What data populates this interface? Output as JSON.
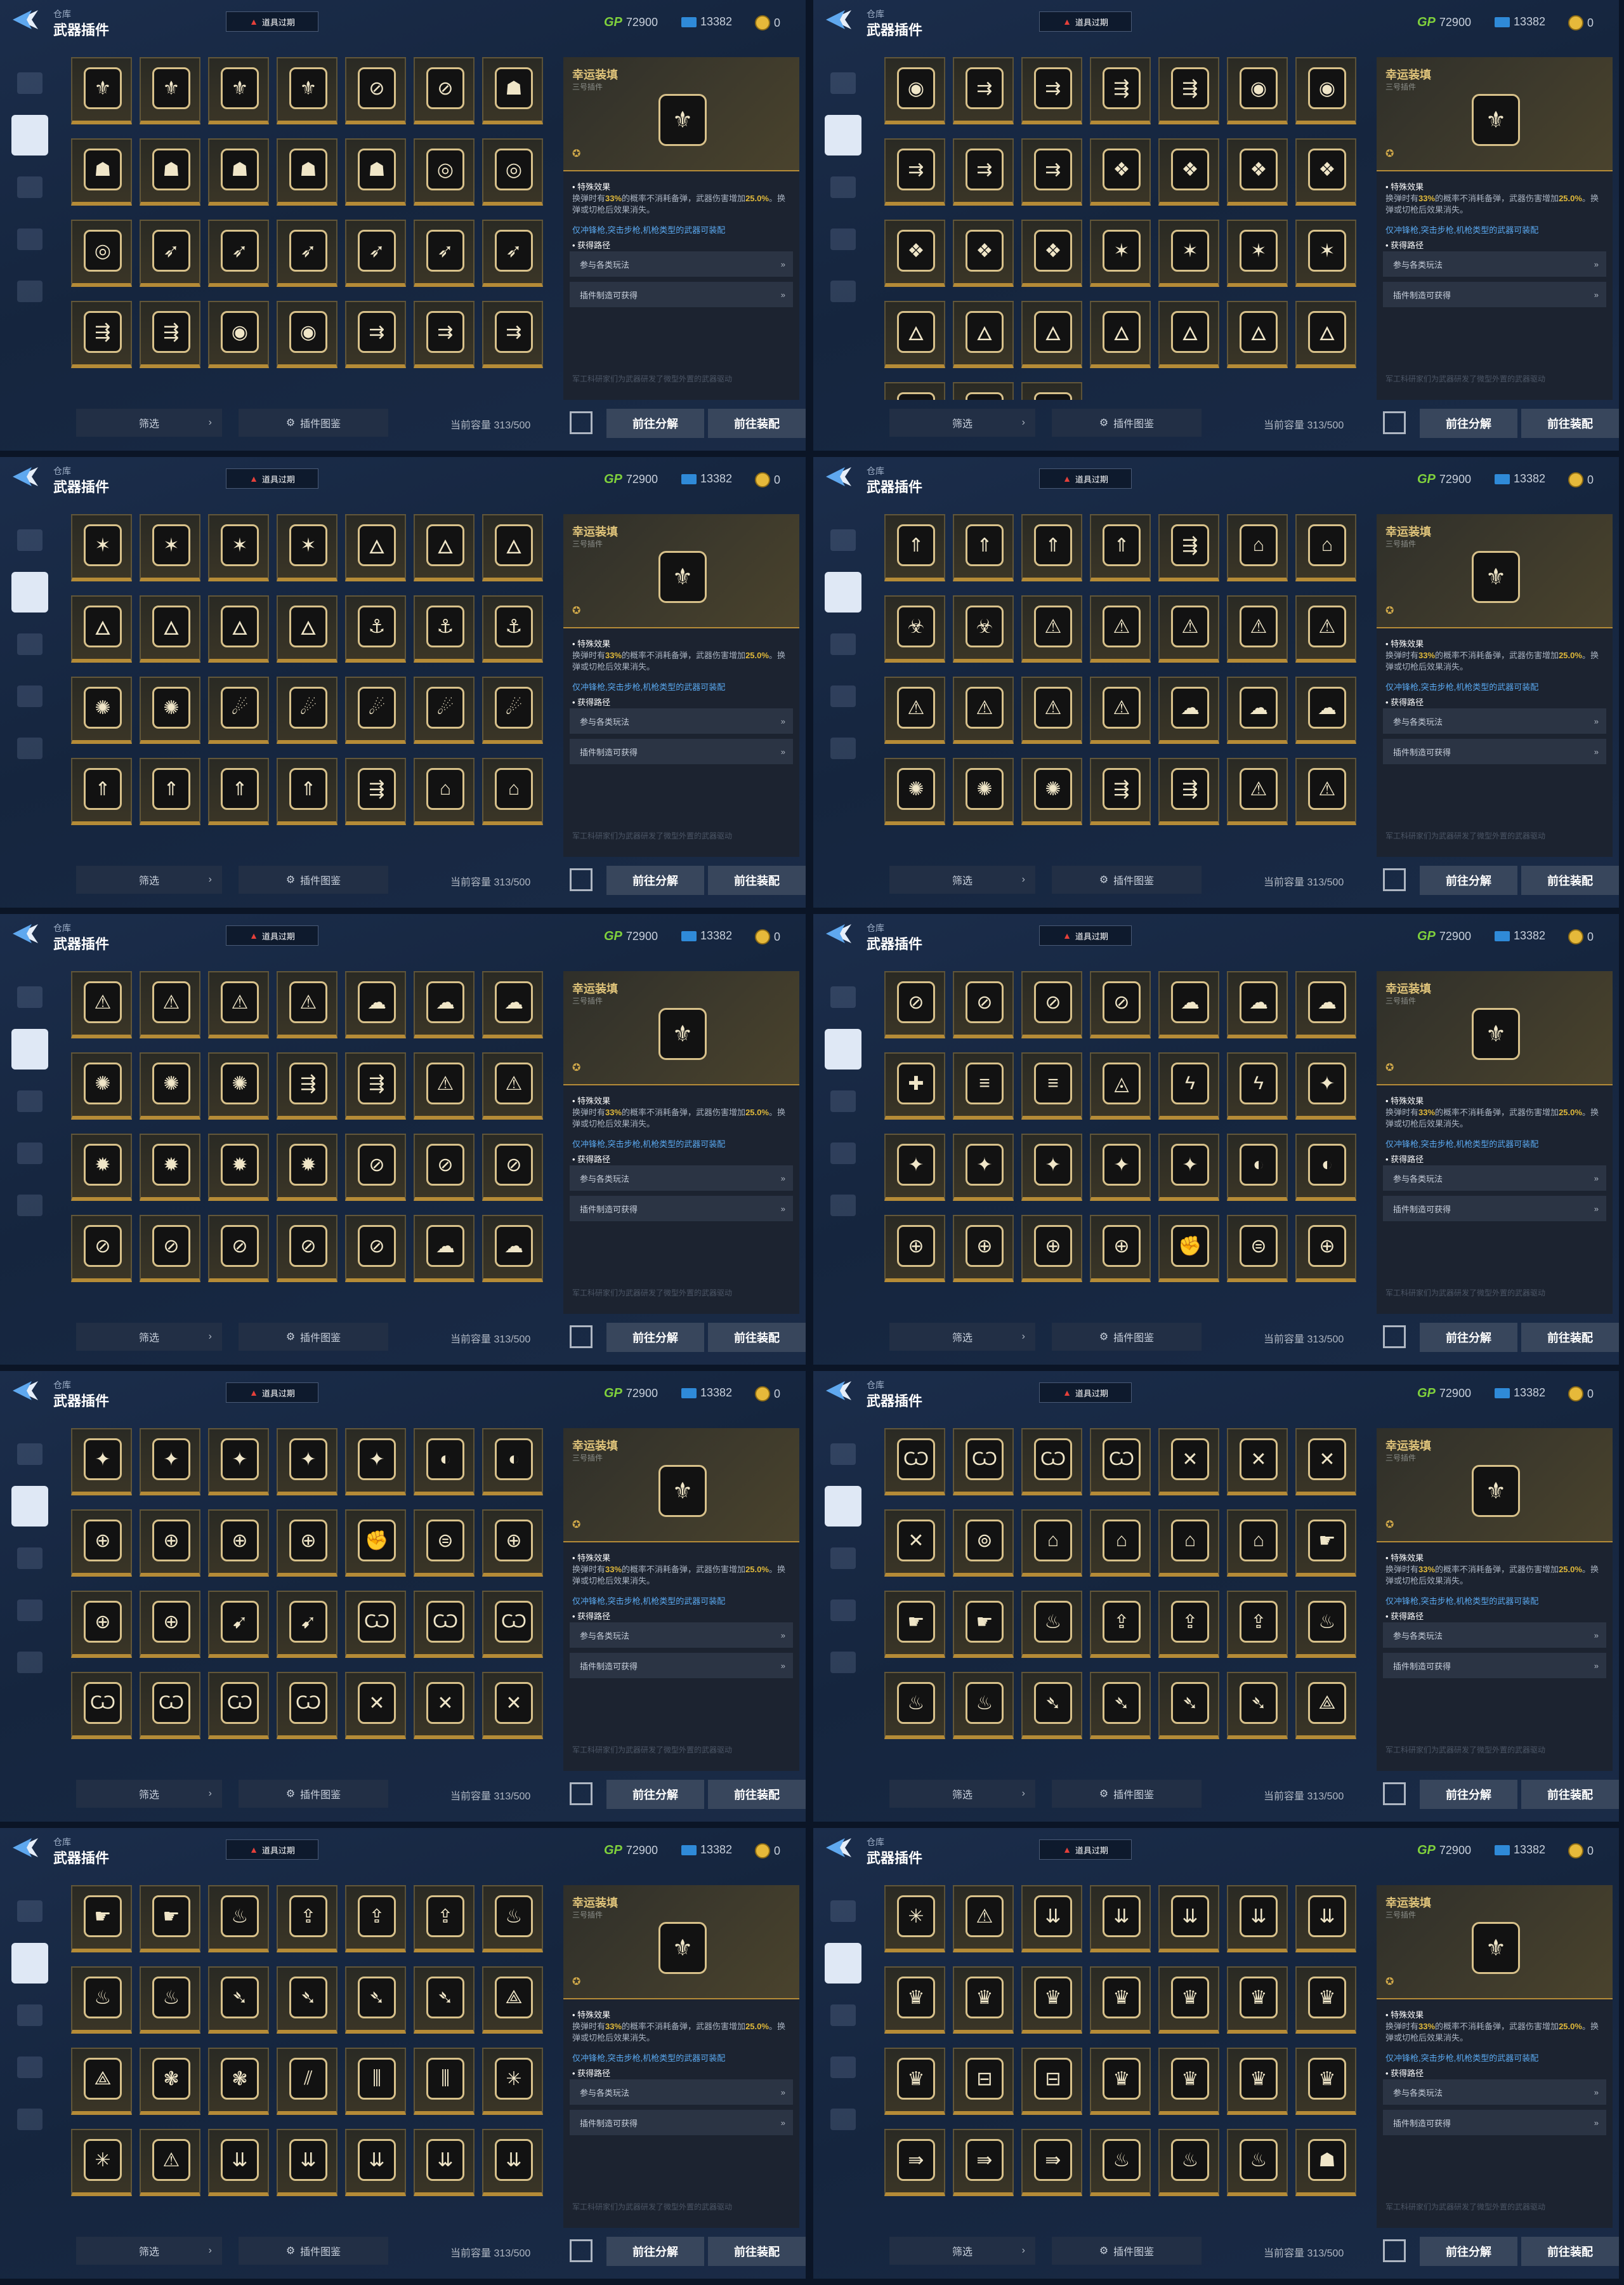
{
  "header": {
    "crumb": "仓库",
    "title": "武器插件",
    "expired_label": "道具过期",
    "gp_label": "GP",
    "gp_value": "72900",
    "ticket_value": "13382",
    "coin_value": "0"
  },
  "sidebar": {
    "items": [
      "pistol-icon",
      "plugin-chip-icon",
      "grenade-icon",
      "rifle-icon",
      "character-icon"
    ],
    "active_index": 1
  },
  "detail": {
    "name": "幸运装填",
    "sub": "三号插件",
    "icon": "⚜",
    "section_effect": "• 特殊效果",
    "effect_text_a": "换弹时有",
    "effect_highlight": "33%",
    "effect_text_b": "的概率不消耗备弹，武器伤害增加",
    "effect_value": "25.0%",
    "effect_text_c": "。换弹或切枪后效果消失。",
    "note": "仅冲锋枪,突击步枪,机枪类型的武器可装配",
    "section_source": "• 获得路径",
    "source_1": "参与各类玩法",
    "source_2": "插件制造可获得",
    "flavor": "军工科研家们为武器研发了微型外置的武器驱动"
  },
  "bottom": {
    "filter": "筛选",
    "atlas": "插件图鉴",
    "capacity": "当前容量 313/500",
    "decompose": "前往分解",
    "equip": "前往装配"
  },
  "panels": [
    {
      "icons": [
        "⚜",
        "⚜",
        "⚜",
        "⚜",
        "⊘",
        "⊘",
        "☗",
        "☗",
        "☗",
        "☗",
        "☗",
        "☗",
        "◎",
        "◎",
        "◎",
        "➶",
        "➶",
        "➶",
        "➶",
        "➶",
        "➶",
        "⇶",
        "⇶",
        "◉",
        "◉",
        "⇉",
        "⇉",
        "⇉"
      ]
    },
    {
      "icons": [
        "◉",
        "⇉",
        "⇉",
        "⇶",
        "⇶",
        "◉",
        "◉",
        "⇉",
        "⇉",
        "⇉",
        "❖",
        "❖",
        "❖",
        "❖",
        "❖",
        "❖",
        "❖",
        "✶",
        "✶",
        "✶",
        "✶",
        "🜂",
        "🜂",
        "🜂",
        "🜂",
        "🜂",
        "🜂",
        "🜂",
        "⚓",
        "⚓",
        "⚓"
      ]
    },
    {
      "icons": [
        "✶",
        "✶",
        "✶",
        "✶",
        "🜂",
        "🜂",
        "🜂",
        "🜂",
        "🜂",
        "🜂",
        "🜂",
        "⚓",
        "⚓",
        "⚓",
        "✺",
        "✺",
        "☄",
        "☄",
        "☄",
        "☄",
        "☄",
        "⇑",
        "⇑",
        "⇑",
        "⇑",
        "⇶",
        "⌂",
        "⌂"
      ]
    },
    {
      "icons": [
        "⇑",
        "⇑",
        "⇑",
        "⇑",
        "⇶",
        "⌂",
        "⌂",
        "☣",
        "☣",
        "⚠",
        "⚠",
        "⚠",
        "⚠",
        "⚠",
        "⚠",
        "⚠",
        "⚠",
        "⚠",
        "☁",
        "☁",
        "☁",
        "✺",
        "✺",
        "✺",
        "⇶",
        "⇶",
        "⚠",
        "⚠"
      ]
    },
    {
      "icons": [
        "⚠",
        "⚠",
        "⚠",
        "⚠",
        "☁",
        "☁",
        "☁",
        "✺",
        "✺",
        "✺",
        "⇶",
        "⇶",
        "⚠",
        "⚠",
        "✹",
        "✹",
        "✹",
        "✹",
        "⊘",
        "⊘",
        "⊘",
        "⊘",
        "⊘",
        "⊘",
        "⊘",
        "⊘",
        "☁",
        "☁"
      ]
    },
    {
      "icons": [
        "⊘",
        "⊘",
        "⊘",
        "⊘",
        "☁",
        "☁",
        "☁",
        "✚",
        "≡",
        "≡",
        "◬",
        "ϟ",
        "ϟ",
        "✦",
        "✦",
        "✦",
        "✦",
        "✦",
        "✦",
        "◐",
        "◐",
        "⊕",
        "⊕",
        "⊕",
        "⊕",
        "✊",
        "⊜",
        "⊕"
      ]
    },
    {
      "icons": [
        "✦",
        "✦",
        "✦",
        "✦",
        "✦",
        "◐",
        "◐",
        "⊕",
        "⊕",
        "⊕",
        "⊕",
        "✊",
        "⊜",
        "⊕",
        "⊕",
        "⊕",
        "➹",
        "➹",
        "Ѡ",
        "Ѡ",
        "Ѡ",
        "Ѡ",
        "Ѡ",
        "Ѡ",
        "Ѡ",
        "✕",
        "✕",
        "✕"
      ]
    },
    {
      "icons": [
        "Ѡ",
        "Ѡ",
        "Ѡ",
        "Ѡ",
        "✕",
        "✕",
        "✕",
        "✕",
        "⊚",
        "⌂",
        "⌂",
        "⌂",
        "⌂",
        "☛",
        "☛",
        "☛",
        "♨",
        "⇪",
        "⇪",
        "⇪",
        "♨",
        "♨",
        "♨",
        "➴",
        "➴",
        "➴",
        "➴",
        "⟁"
      ]
    },
    {
      "icons": [
        "☛",
        "☛",
        "♨",
        "⇪",
        "⇪",
        "⇪",
        "♨",
        "♨",
        "♨",
        "➴",
        "➴",
        "➴",
        "➴",
        "⟁",
        "⟁",
        "❃",
        "❃",
        "⫽",
        "⫼",
        "⫼",
        "✳",
        "✳",
        "⚠",
        "⇊",
        "⇊",
        "⇊",
        "⇊",
        "⇊"
      ]
    },
    {
      "icons": [
        "✳",
        "⚠",
        "⇊",
        "⇊",
        "⇊",
        "⇊",
        "⇊",
        "♛",
        "♛",
        "♛",
        "♛",
        "♛",
        "♛",
        "♛",
        "♛",
        "⊟",
        "⊟",
        "♛",
        "♛",
        "♛",
        "♛",
        "⇛",
        "⇛",
        "⇛",
        "♨",
        "♨",
        "♨",
        "☗"
      ]
    }
  ]
}
